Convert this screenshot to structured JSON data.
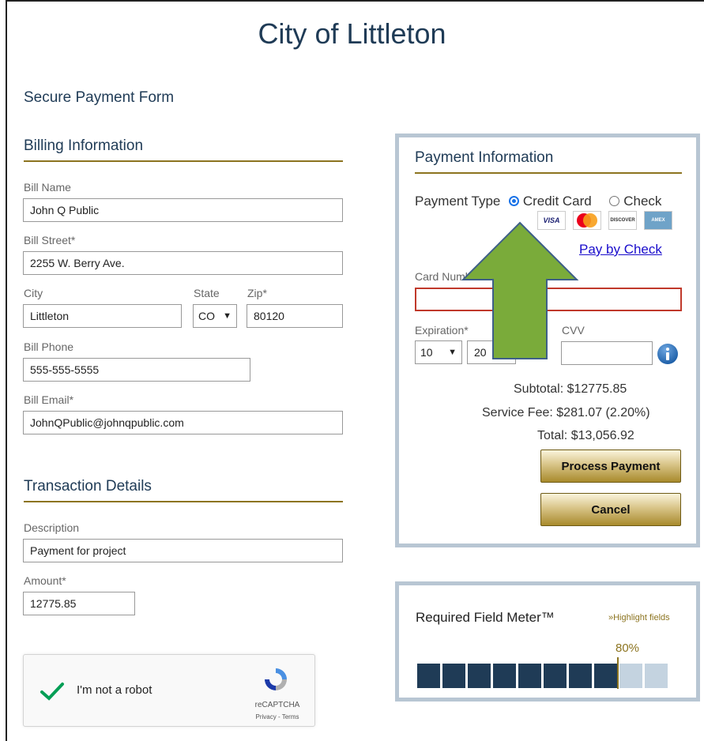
{
  "page": {
    "title": "City of Littleton",
    "form_title": "Secure Payment Form"
  },
  "billing": {
    "heading": "Billing Information",
    "bill_name_label": "Bill Name",
    "bill_name": "John Q Public",
    "bill_street_label": "Bill Street*",
    "bill_street": "2255 W. Berry  Ave.",
    "city_label": "City",
    "city": "Littleton",
    "state_label": "State",
    "state": "CO",
    "zip_label": "Zip*",
    "zip": "80120",
    "phone_label": "Bill Phone",
    "phone": "555-555-5555",
    "email_label": "Bill Email*",
    "email": "JohnQPublic@johnqpublic.com"
  },
  "transaction": {
    "heading": "Transaction Details",
    "description_label": "Description",
    "description": "Payment for project",
    "amount_label": "Amount*",
    "amount": "12775.85"
  },
  "captcha": {
    "label": "I'm not a robot",
    "brand": "reCAPTCHA",
    "links": "Privacy - Terms"
  },
  "payment": {
    "heading": "Payment Information",
    "type_label": "Payment Type",
    "option_credit": "Credit Card",
    "option_check": "Check",
    "selected": "Credit Card",
    "cards": [
      "VISA",
      "MasterCard",
      "DISCOVER",
      "AMEX"
    ],
    "pay_by_check": "Pay by Check",
    "card_number_label": "Card Number*",
    "card_number": "",
    "expiration_label": "Expiration*",
    "exp_month": "10",
    "exp_year": "20",
    "cvv_label": "CVV",
    "cvv": "",
    "subtotal_label": "Subtotal:",
    "subtotal": "$12775.85",
    "fee_label": "Service Fee:",
    "fee": "$281.07 (2.20%)",
    "total_label": "Total:",
    "total": "$13,056.92",
    "process_button": "Process Payment",
    "cancel_button": "Cancel"
  },
  "meter": {
    "title": "Required Field Meter™",
    "highlight_link": "»Highlight fields",
    "percent_label": "80%",
    "percent": 80,
    "segments_filled": 8,
    "segments_total": 10
  },
  "colors": {
    "navy": "#1f3b56",
    "gold": "#8c7420",
    "panel_border": "#b8c6d3",
    "arrow": "#7aab3a",
    "error": "#c0392b"
  }
}
